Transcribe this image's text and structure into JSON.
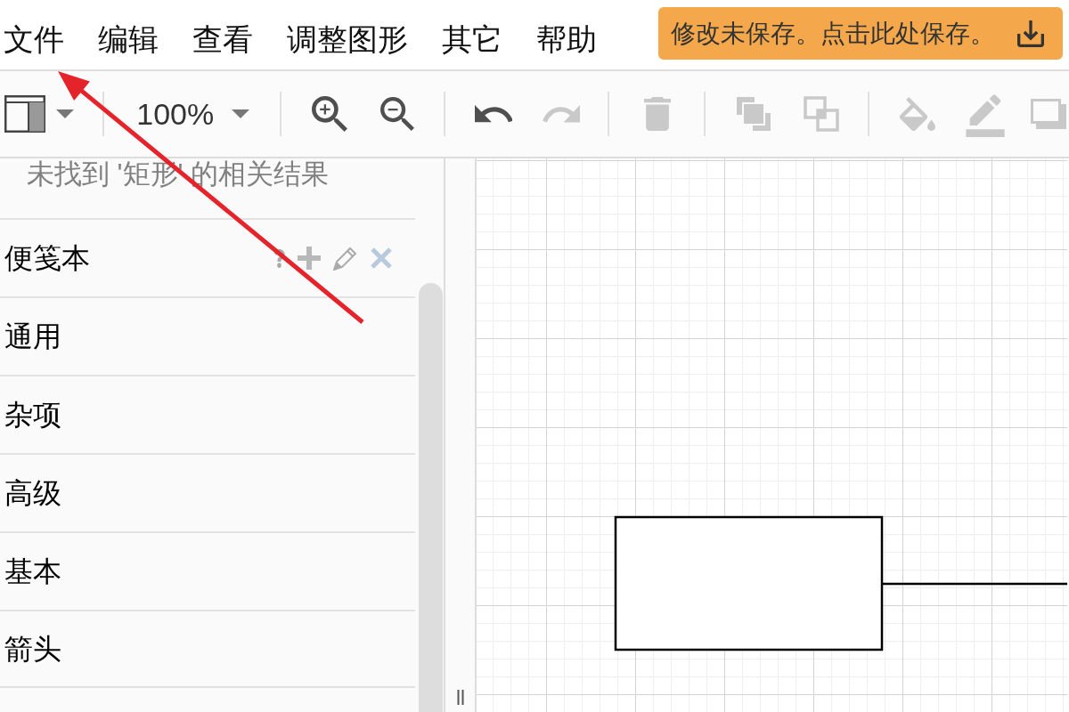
{
  "menu_bar": {
    "items": [
      "文件",
      "编辑",
      "查看",
      "调整图形",
      "其它",
      "帮助"
    ],
    "save_notice": "修改未保存。点击此处保存。"
  },
  "toolbar": {
    "zoom_level": "100%",
    "groups": [
      {
        "buttons": [
          {
            "kind": "zoom-in",
            "disabled": false
          },
          {
            "kind": "zoom-out",
            "disabled": false
          }
        ]
      },
      {
        "buttons": [
          {
            "kind": "undo",
            "disabled": false
          },
          {
            "kind": "redo",
            "disabled": true
          }
        ]
      },
      {
        "buttons": [
          {
            "kind": "delete",
            "disabled": true
          }
        ]
      },
      {
        "buttons": [
          {
            "kind": "to-front",
            "disabled": true
          },
          {
            "kind": "to-back",
            "disabled": true
          }
        ]
      },
      {
        "buttons": [
          {
            "kind": "fill-color",
            "disabled": true
          },
          {
            "kind": "line-color",
            "disabled": true
          },
          {
            "kind": "shadow",
            "disabled": true
          }
        ]
      }
    ]
  },
  "sidebar": {
    "search_message": "未找到 '矩形' 的相关结果",
    "scratchpad": {
      "title": "便笺本"
    },
    "libraries": [
      {
        "title": "通用"
      },
      {
        "title": "杂项"
      },
      {
        "title": "高级"
      },
      {
        "title": "基本"
      },
      {
        "title": "箭头"
      }
    ]
  }
}
